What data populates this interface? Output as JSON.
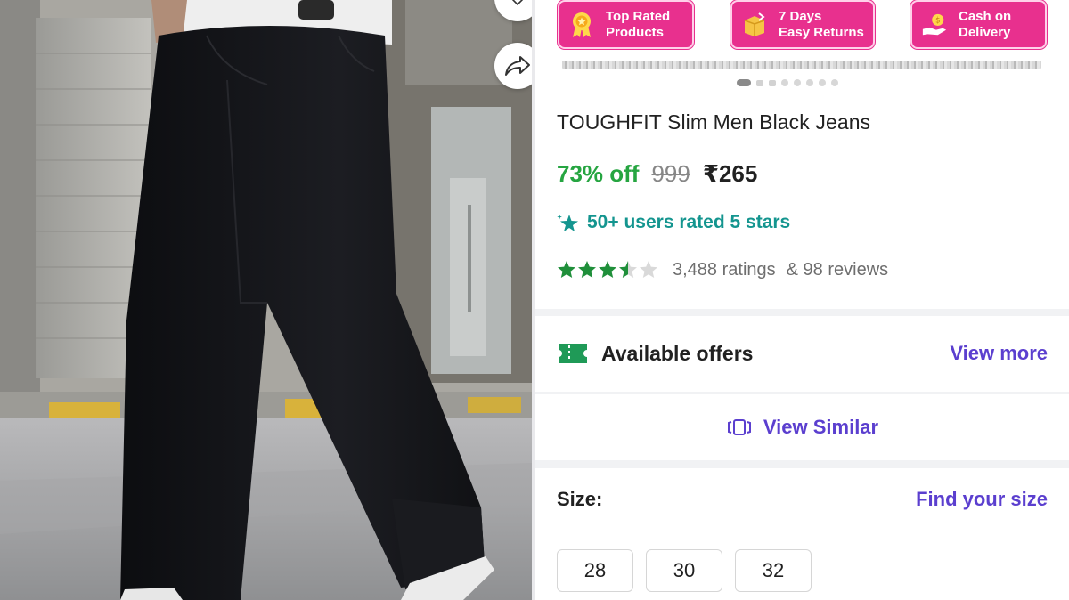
{
  "badges": [
    {
      "line1": "Top Rated",
      "line2": "Products",
      "icon": "medal-icon"
    },
    {
      "line1": "7 Days",
      "line2": "Easy Returns",
      "icon": "return-box-icon"
    },
    {
      "line1": "Cash on",
      "line2": "Delivery",
      "icon": "cash-hand-icon"
    }
  ],
  "image_carousel": {
    "dot_count": 8,
    "active_index": 0
  },
  "product": {
    "title": "TOUGHFIT Slim Men Black Jeans",
    "discount": "73% off",
    "mrp": "999",
    "price": "₹265",
    "users_rated": "50+ users rated 5 stars",
    "rating": 3.5,
    "ratings_count": "3,488 ratings",
    "reviews_count": "& 98 reviews"
  },
  "offers": {
    "label": "Available offers",
    "view_more": "View more",
    "icon": "offer-ticket-icon"
  },
  "similar": {
    "label": "View Similar",
    "icon": "view-similar-icon"
  },
  "size": {
    "label": "Size:",
    "find": "Find your size",
    "options": [
      "28",
      "30",
      "32"
    ]
  },
  "colors": {
    "accent_pink": "#e8308e",
    "discount_green": "#26a541",
    "link_purple": "#5b3fcf",
    "teal": "#14958f",
    "star_green": "#1f8f3a"
  }
}
